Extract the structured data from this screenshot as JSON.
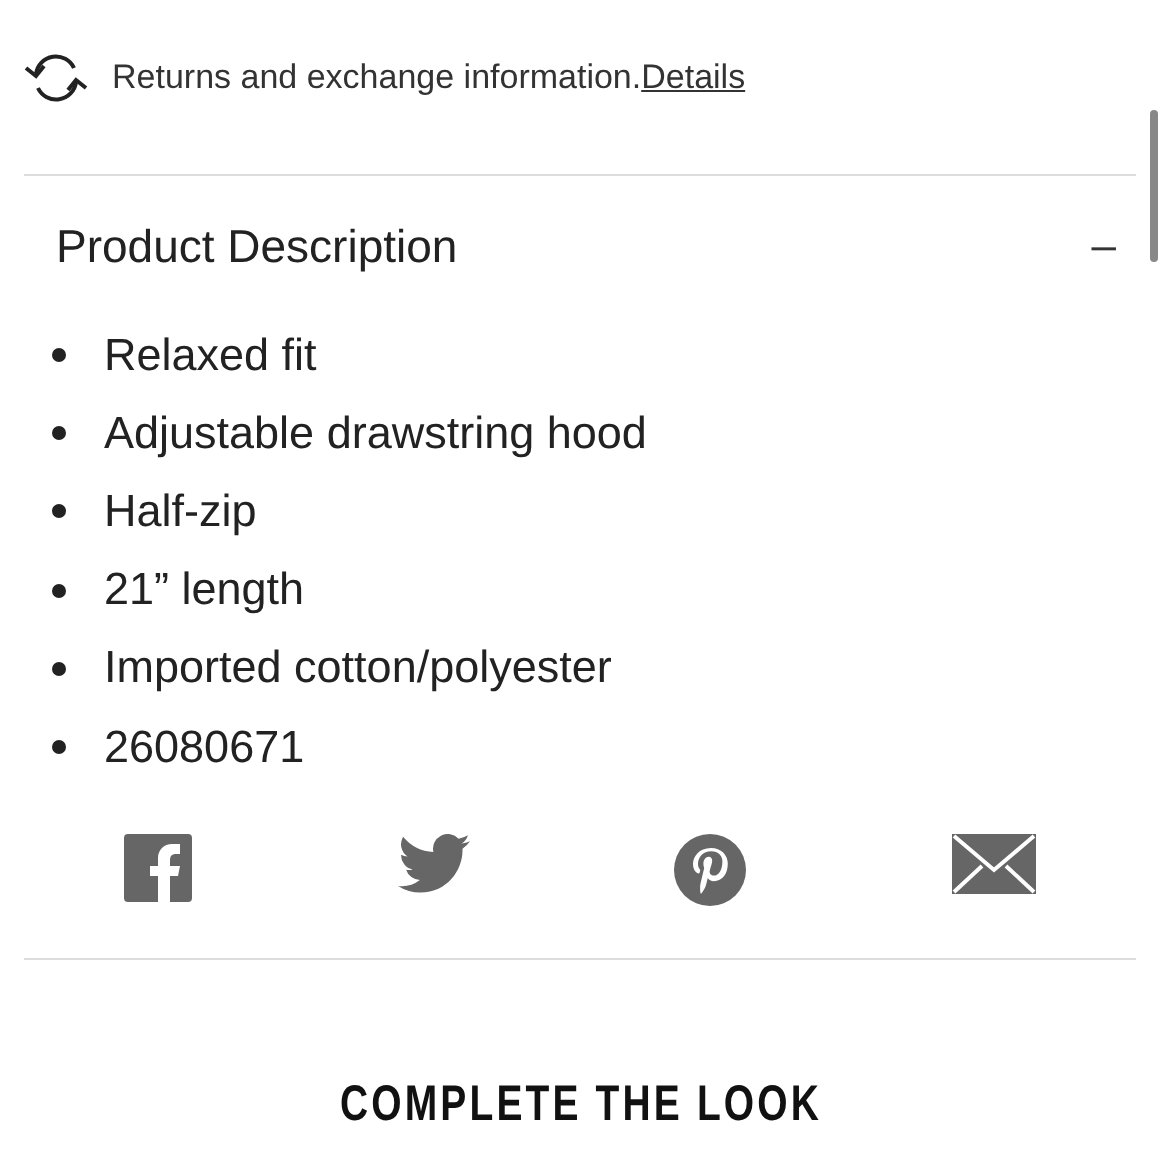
{
  "returns": {
    "text": "Returns and exchange information.",
    "link": "Details"
  },
  "description": {
    "title": "Product Description",
    "toggle": "–",
    "expanded": true,
    "items": [
      "Relaxed fit",
      "Adjustable drawstring hood",
      "Half-zip",
      "21” length",
      "Imported cotton/polyester",
      "26080671"
    ]
  },
  "share": [
    {
      "kind": "facebook"
    },
    {
      "kind": "twitter"
    },
    {
      "kind": "pinterest"
    },
    {
      "kind": "email"
    }
  ],
  "section_title": "COMPLETE THE LOOK"
}
